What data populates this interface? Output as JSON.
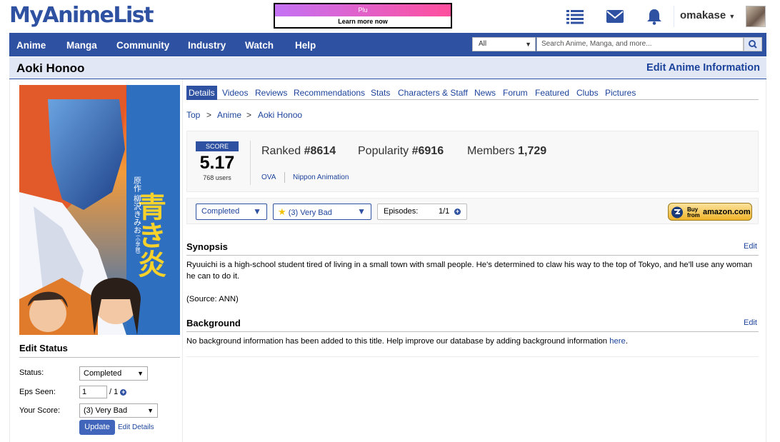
{
  "header": {
    "logo": "MyAnimeList",
    "ad_top": "Plu",
    "ad_bottom": "Learn more now",
    "username": "omakase",
    "icons": [
      "list-icon",
      "mail-icon",
      "bell-icon"
    ]
  },
  "nav": {
    "items": [
      "Anime",
      "Manga",
      "Community",
      "Industry",
      "Watch",
      "Help"
    ],
    "search_filter": "All",
    "search_placeholder": "Search Anime, Manga, and more..."
  },
  "page": {
    "title": "Aoki Honoo",
    "edit_info": "Edit Anime Information"
  },
  "tabs": [
    "Details",
    "Videos",
    "Reviews",
    "Recommendations",
    "Stats",
    "Characters & Staff",
    "News",
    "Forum",
    "Featured",
    "Clubs",
    "Pictures"
  ],
  "breadcrumb": [
    "Top",
    "Anime",
    "Aoki Honoo"
  ],
  "stats": {
    "score_label": "SCORE",
    "score": "5.17",
    "score_users": "768 users",
    "ranked_label": "Ranked",
    "ranked": "#8614",
    "popularity_label": "Popularity",
    "popularity": "#6916",
    "members_label": "Members",
    "members": "1,729",
    "type": "OVA",
    "studio": "Nippon Animation"
  },
  "status_row": {
    "status": "Completed",
    "rating": "(3) Very Bad",
    "episodes_label": "Episodes:",
    "episodes": "1/1",
    "amazon_line1": "Buy",
    "amazon_line2": "from",
    "amazon_brand": "amazon.com"
  },
  "synopsis": {
    "heading": "Synopsis",
    "edit": "Edit",
    "text": "Ryuuichi is a high-school student tired of living in a small town with small people. He's determined to claw his way to the top of Tokyo, and he'll use any woman he can to do it.",
    "source": "(Source: ANN)"
  },
  "background": {
    "heading": "Background",
    "edit": "Edit",
    "text": "No background information has been added to this title. Help improve our database by adding background information ",
    "link": "here",
    "end": "."
  },
  "edit_status": {
    "heading": "Edit Status",
    "status_label": "Status:",
    "status_value": "Completed",
    "eps_label": "Eps Seen:",
    "eps_value": "1",
    "eps_total": "/ 1",
    "score_label": "Your Score:",
    "score_value": "(3) Very Bad",
    "update": "Update",
    "edit_details": "Edit Details"
  },
  "poster": {
    "vertical_title": "青き炎",
    "author": "原作 柳沢きみお",
    "publisher": "(小学館)"
  },
  "colors": {
    "brand": "#2e51a2",
    "link": "#1c439b",
    "titlebar": "#e1e7f5"
  }
}
